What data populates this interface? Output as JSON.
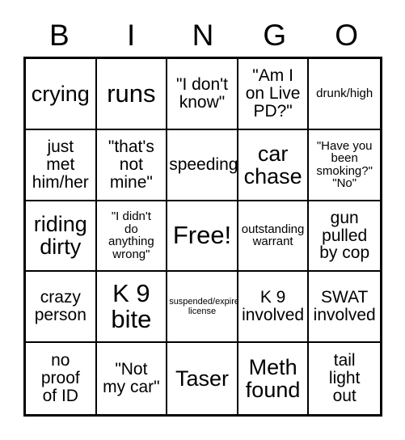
{
  "card": {
    "headers": [
      "B",
      "I",
      "N",
      "G",
      "O"
    ],
    "free_space_index": 12,
    "colors": {
      "background": "#ffffff",
      "text": "#000000",
      "border": "#000000"
    },
    "cells": [
      {
        "text": "crying",
        "size": "lg"
      },
      {
        "text": "runs",
        "size": "xl"
      },
      {
        "text": "\"I don't\nknow\"",
        "size": "md"
      },
      {
        "text": "\"Am I\non Live\nPD?\"",
        "size": "md"
      },
      {
        "text": "drunk/high",
        "size": "sm"
      },
      {
        "text": "just\nmet\nhim/her",
        "size": "md"
      },
      {
        "text": "\"that's\nnot\nmine\"",
        "size": "md"
      },
      {
        "text": "speeding",
        "size": "md"
      },
      {
        "text": "car\nchase",
        "size": "lg"
      },
      {
        "text": "\"Have you\nbeen\nsmoking?\"\n\"No\"",
        "size": "sm"
      },
      {
        "text": "riding\ndirty",
        "size": "lg"
      },
      {
        "text": "\"I didn't\ndo\nanything\nwrong\"",
        "size": "sm"
      },
      {
        "text": "Free!",
        "size": "xl"
      },
      {
        "text": "outstanding\nwarrant",
        "size": "sm"
      },
      {
        "text": "gun\npulled\nby cop",
        "size": "md"
      },
      {
        "text": "crazy\nperson",
        "size": "md"
      },
      {
        "text": "K 9\nbite",
        "size": "xl"
      },
      {
        "text": "suspended/expired\nlicense",
        "size": "xs"
      },
      {
        "text": "K 9\ninvolved",
        "size": "md"
      },
      {
        "text": "SWAT\ninvolved",
        "size": "md"
      },
      {
        "text": "no\nproof\nof ID",
        "size": "md"
      },
      {
        "text": "\"Not\nmy car\"",
        "size": "md"
      },
      {
        "text": "Taser",
        "size": "lg"
      },
      {
        "text": "Meth\nfound",
        "size": "lg"
      },
      {
        "text": "tail\nlight\nout",
        "size": "md"
      }
    ]
  }
}
